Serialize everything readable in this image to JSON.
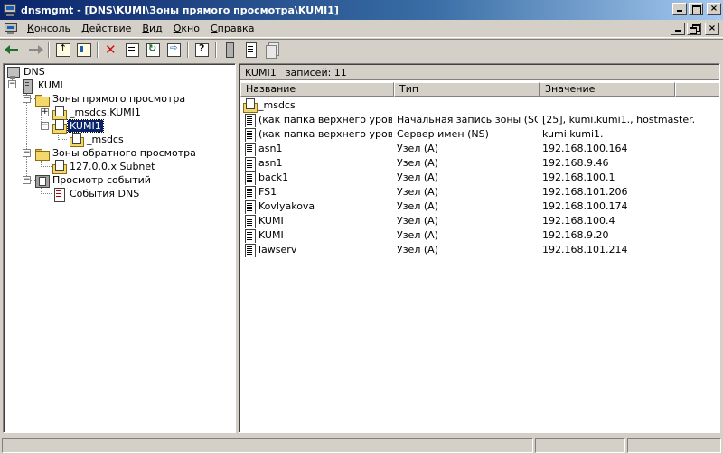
{
  "window": {
    "title": "dnsmgmt - [DNS\\KUMI\\Зоны прямого просмотра\\KUMI1]",
    "min_glyph": "_",
    "max_glyph": "□",
    "close_glyph": "×",
    "restore_glyph": "▭"
  },
  "menu": {
    "items": [
      {
        "key": "К",
        "rest": "онсоль"
      },
      {
        "key": "Д",
        "rest": "ействие"
      },
      {
        "key": "В",
        "rest": "ид"
      },
      {
        "key": "О",
        "rest": "кно"
      },
      {
        "key": "С",
        "rest": "правка"
      }
    ]
  },
  "toolbar": {
    "icons": [
      "back-arrow-icon",
      "forward-arrow-icon",
      "up-folder-icon",
      "show-hide-tree-icon",
      "delete-icon",
      "properties-icon",
      "refresh-icon",
      "export-list-icon",
      "help-icon",
      "server-icon",
      "record-icon",
      "copy-records-icon"
    ]
  },
  "tree": {
    "root": "DNS",
    "server": "KUMI",
    "forward_zones": "Зоны прямого просмотра",
    "msdcs_zone": "_msdcs.KUMI1",
    "kumi1_zone": "KUMI1",
    "msdcs_sub": "_msdcs",
    "reverse_zones": "Зоны обратного просмотра",
    "subnet": "127.0.0.x Subnet",
    "event_viewer": "Просмотр событий",
    "dns_events": "События DNS",
    "expand_minus": "−",
    "expand_plus": "+"
  },
  "detail": {
    "zone_name": "KUMI1",
    "records_label": "записей: 11",
    "columns": [
      "Название",
      "Тип",
      "Значение"
    ],
    "rows": [
      {
        "icon": "folder",
        "name": "_msdcs",
        "type": "",
        "value": ""
      },
      {
        "icon": "record",
        "name": "(как папка верхнего уровня)",
        "type": "Начальная запись зоны (SOA)",
        "value": "[25], kumi.kumi1., hostmaster."
      },
      {
        "icon": "record",
        "name": "(как папка верхнего уровня)",
        "type": "Сервер имен (NS)",
        "value": "kumi.kumi1."
      },
      {
        "icon": "record",
        "name": "asn1",
        "type": "Узел (A)",
        "value": "192.168.100.164"
      },
      {
        "icon": "record",
        "name": "asn1",
        "type": "Узел (A)",
        "value": "192.168.9.46"
      },
      {
        "icon": "record",
        "name": "back1",
        "type": "Узел (A)",
        "value": "192.168.100.1"
      },
      {
        "icon": "record",
        "name": "FS1",
        "type": "Узел (A)",
        "value": "192.168.101.206"
      },
      {
        "icon": "record",
        "name": "Kovlyakova",
        "type": "Узел (A)",
        "value": "192.168.100.174"
      },
      {
        "icon": "record",
        "name": "KUMI",
        "type": "Узел (A)",
        "value": "192.168.100.4"
      },
      {
        "icon": "record",
        "name": "KUMI",
        "type": "Узел (A)",
        "value": "192.168.9.20"
      },
      {
        "icon": "record",
        "name": "lawserv",
        "type": "Узел (A)",
        "value": "192.168.101.214"
      }
    ]
  }
}
